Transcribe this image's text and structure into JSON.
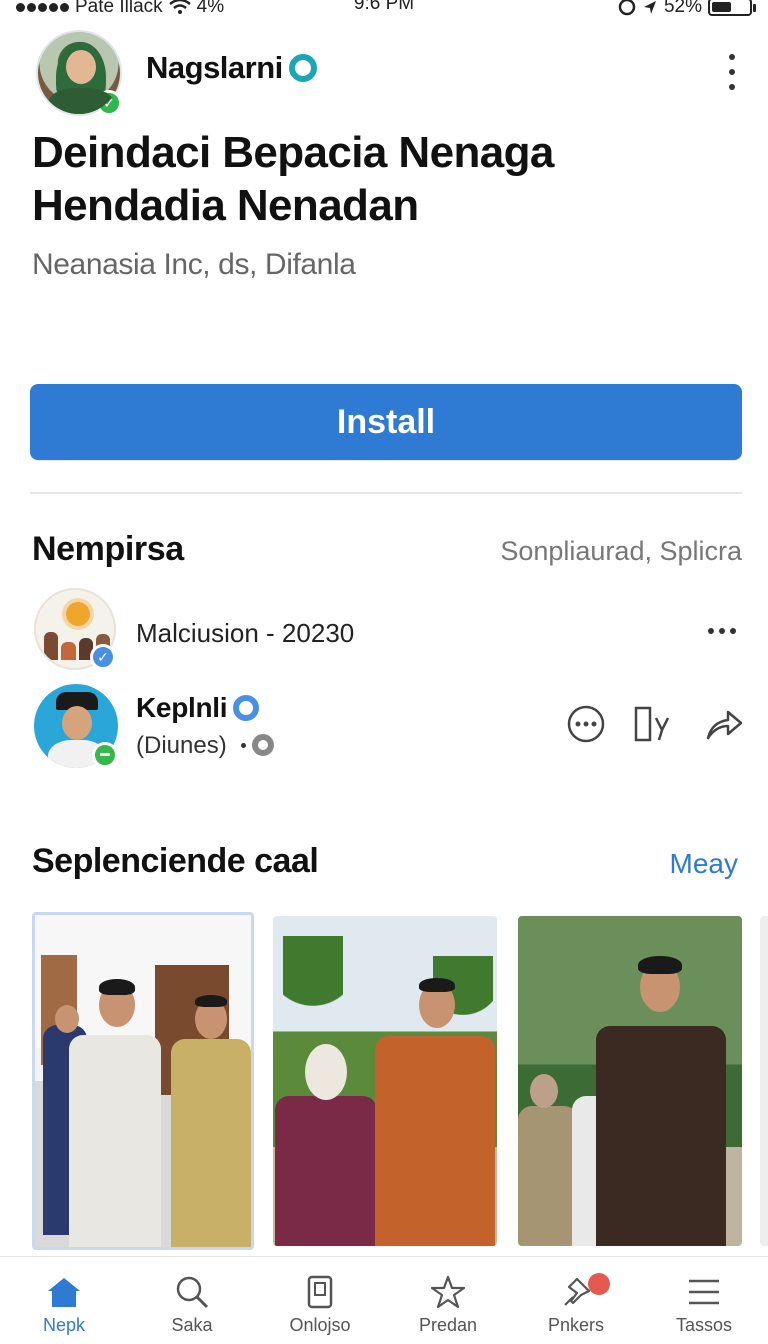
{
  "status_bar": {
    "carrier": "Pate Illack",
    "signal_label": "4%",
    "time": "9:6 PM",
    "battery": "52%",
    "battery_level_percent": 52
  },
  "header": {
    "author_name": "Nagslarni",
    "app_title_line1": "Deindaci Bepacia Nenaga",
    "app_title_line2": "Hendadia Nenadan",
    "subtitle": "Neanasia Inc, ds, Difanla",
    "install_label": "Install"
  },
  "section": {
    "title": "Nempirsa",
    "meta": "Sonpliaurad, Splicra",
    "row1_text": "Malciusion - 20230",
    "row2_name": "Keplnli",
    "row2_sub": "(Diunes)"
  },
  "media": {
    "title": "Seplenciende caal",
    "link": "Meay"
  },
  "bottom_nav": {
    "items": [
      {
        "label": "Nepk",
        "icon": "home-icon",
        "active": true
      },
      {
        "label": "Saka",
        "icon": "search-icon",
        "active": false
      },
      {
        "label": "Onlojso",
        "icon": "tablet-icon",
        "active": false
      },
      {
        "label": "Predan",
        "icon": "star-icon",
        "active": false
      },
      {
        "label": "Pnkers",
        "icon": "pin-icon",
        "active": false,
        "badge": true
      },
      {
        "label": "Tassos",
        "icon": "menu-icon",
        "active": false
      }
    ]
  },
  "colors": {
    "accent": "#2f7ad3",
    "teal_badge": "#1aa6b7",
    "verified_green": "#2eb84a",
    "verified_blue": "#4a90e2",
    "notification_red": "#e5594f"
  }
}
